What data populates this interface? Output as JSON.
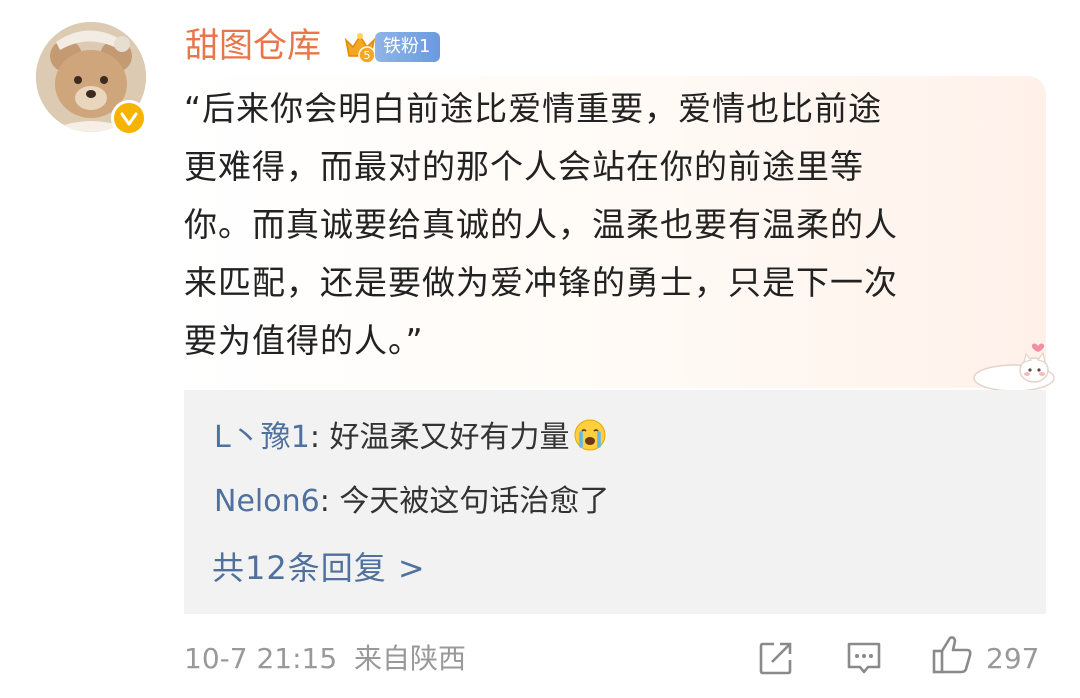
{
  "post": {
    "username": "甜图仓库",
    "fan_badge": "铁粉1",
    "crown_level": "5",
    "quote_lines": [
      "“后来你会明白前途比爱情重要，爱情也比前途",
      "更难得，而最对的那个人会站在你的前途里等",
      "你。而真诚要给真诚的人，温柔也要有温柔的人",
      "来匹配，还是要做为爱冲锋的勇士，只是下一次",
      "要为值得的人。”"
    ]
  },
  "replies": [
    {
      "name": "L丶豫1",
      "separator": ": ",
      "text": "好温柔又好有力量",
      "emoji": "crying-emoji"
    },
    {
      "name": "Nelon6",
      "separator": ": ",
      "text": "今天被这句话治愈了"
    }
  ],
  "more_replies": "共12条回复 >",
  "footer": {
    "timestamp": "10-7 21:15",
    "source": "来自陕西",
    "like_count": "297",
    "icons": [
      "share-icon",
      "comment-icon",
      "like-icon"
    ]
  },
  "colors": {
    "username": "#e8764b",
    "link": "#50719d",
    "meta": "#999999",
    "verified": "#f6b400",
    "fan_badge": "#6a9ae0"
  }
}
